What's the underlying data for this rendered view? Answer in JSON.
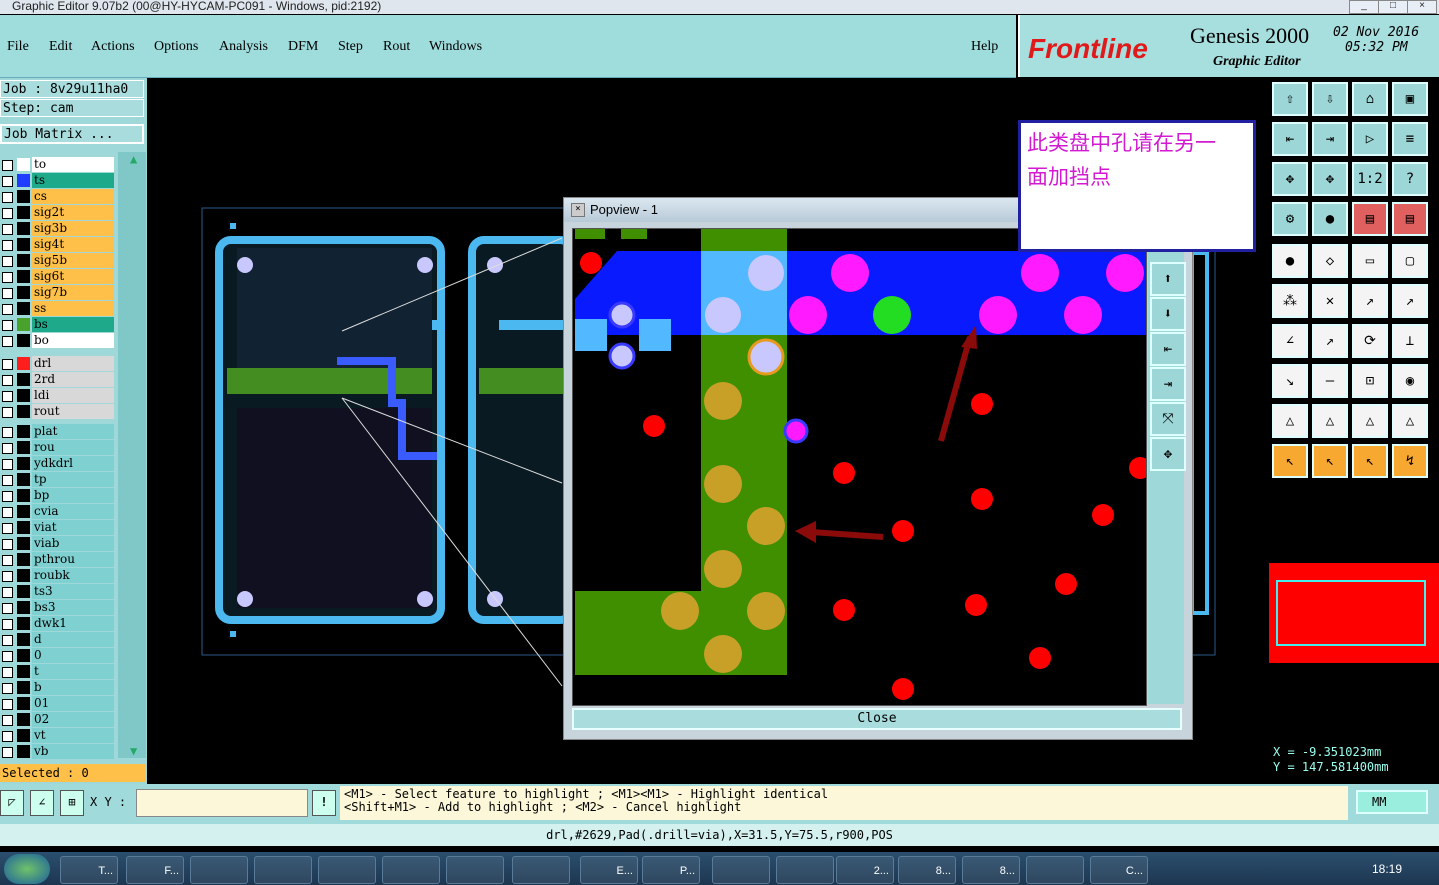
{
  "window": {
    "title": "Graphic Editor 9.07b2 (00@HY-HYCAM-PC091 - Windows, pid:2192)"
  },
  "menu": [
    "File",
    "Edit",
    "Actions",
    "Options",
    "Analysis",
    "DFM",
    "Step",
    "Rout",
    "Windows"
  ],
  "help": "Help",
  "brand": {
    "logo": "Frontline",
    "product": "Genesis 2000",
    "subtitle": "Graphic Editor",
    "date": "02 Nov 2016",
    "time": "05:32 PM"
  },
  "job": {
    "job_label": "Job : 8v29u11ha0",
    "step_label": "Step: cam",
    "matrix": "Job Matrix ..."
  },
  "layers_top": [
    {
      "name": "to",
      "bg": "#ffffff",
      "sw": "#ffffff"
    },
    {
      "name": "ts",
      "bg": "#1ea98a",
      "sw": "#1f3cff"
    },
    {
      "name": "cs",
      "bg": "#ffc04a",
      "sw": "#000000"
    },
    {
      "name": "sig2t",
      "bg": "#ffc04a",
      "sw": "#000000"
    },
    {
      "name": "sig3b",
      "bg": "#ffc04a",
      "sw": "#000000"
    },
    {
      "name": "sig4t",
      "bg": "#ffc04a",
      "sw": "#000000"
    },
    {
      "name": "sig5b",
      "bg": "#ffc04a",
      "sw": "#000000"
    },
    {
      "name": "sig6t",
      "bg": "#ffc04a",
      "sw": "#000000"
    },
    {
      "name": "sig7b",
      "bg": "#ffc04a",
      "sw": "#000000"
    },
    {
      "name": "ss",
      "bg": "#ffc04a",
      "sw": "#000000"
    },
    {
      "name": "bs",
      "bg": "#1ea98a",
      "sw": "#49a22c"
    },
    {
      "name": "bo",
      "bg": "#ffffff",
      "sw": "#000000"
    }
  ],
  "layers_drill": [
    {
      "name": "drl",
      "bg": "#d8d8d8",
      "sw": "#ff1e1e"
    },
    {
      "name": "2rd",
      "bg": "#d8d8d8",
      "sw": "#000000"
    },
    {
      "name": "ldi",
      "bg": "#d8d8d8",
      "sw": "#000000"
    },
    {
      "name": "rout",
      "bg": "#d8d8d8",
      "sw": "#000000"
    }
  ],
  "layers_misc": [
    "plat",
    "rou",
    "ydkdrl",
    "tp",
    "bp",
    "cvia",
    "viat",
    "viab",
    "pthrou",
    "roubk",
    "ts3",
    "bs3",
    "dwk1",
    "d",
    "0",
    "t",
    "b",
    "01",
    "02",
    "vt",
    "vb"
  ],
  "selected": "Selected : 0",
  "xy_label": "X Y :",
  "xy_value": "",
  "message_line1": "<M1> - Select feature to highlight ; <M1><M1> - Highlight identical",
  "message_line2": "<Shift+M1> - Add to highlight ; <M2> - Cancel highlight",
  "units": "MM",
  "info": "drl,#2629,Pad(.drill=via),X=31.5,Y=75.5,r900,POS",
  "coords": {
    "x": "X = -9.351023mm",
    "y": "Y = 147.581400mm"
  },
  "popview": {
    "title": "Popview - 1",
    "close": "Close"
  },
  "annotation": {
    "line1": "此类盘中孔请在另一",
    "line2": "面加挡点"
  },
  "taskbar": {
    "clock": "18:19",
    "items": [
      "T...",
      "F...",
      "",
      "",
      "",
      "",
      "",
      "",
      "E...",
      "P...",
      "",
      "",
      "2...",
      "8...",
      "8...",
      "",
      "C..."
    ]
  }
}
